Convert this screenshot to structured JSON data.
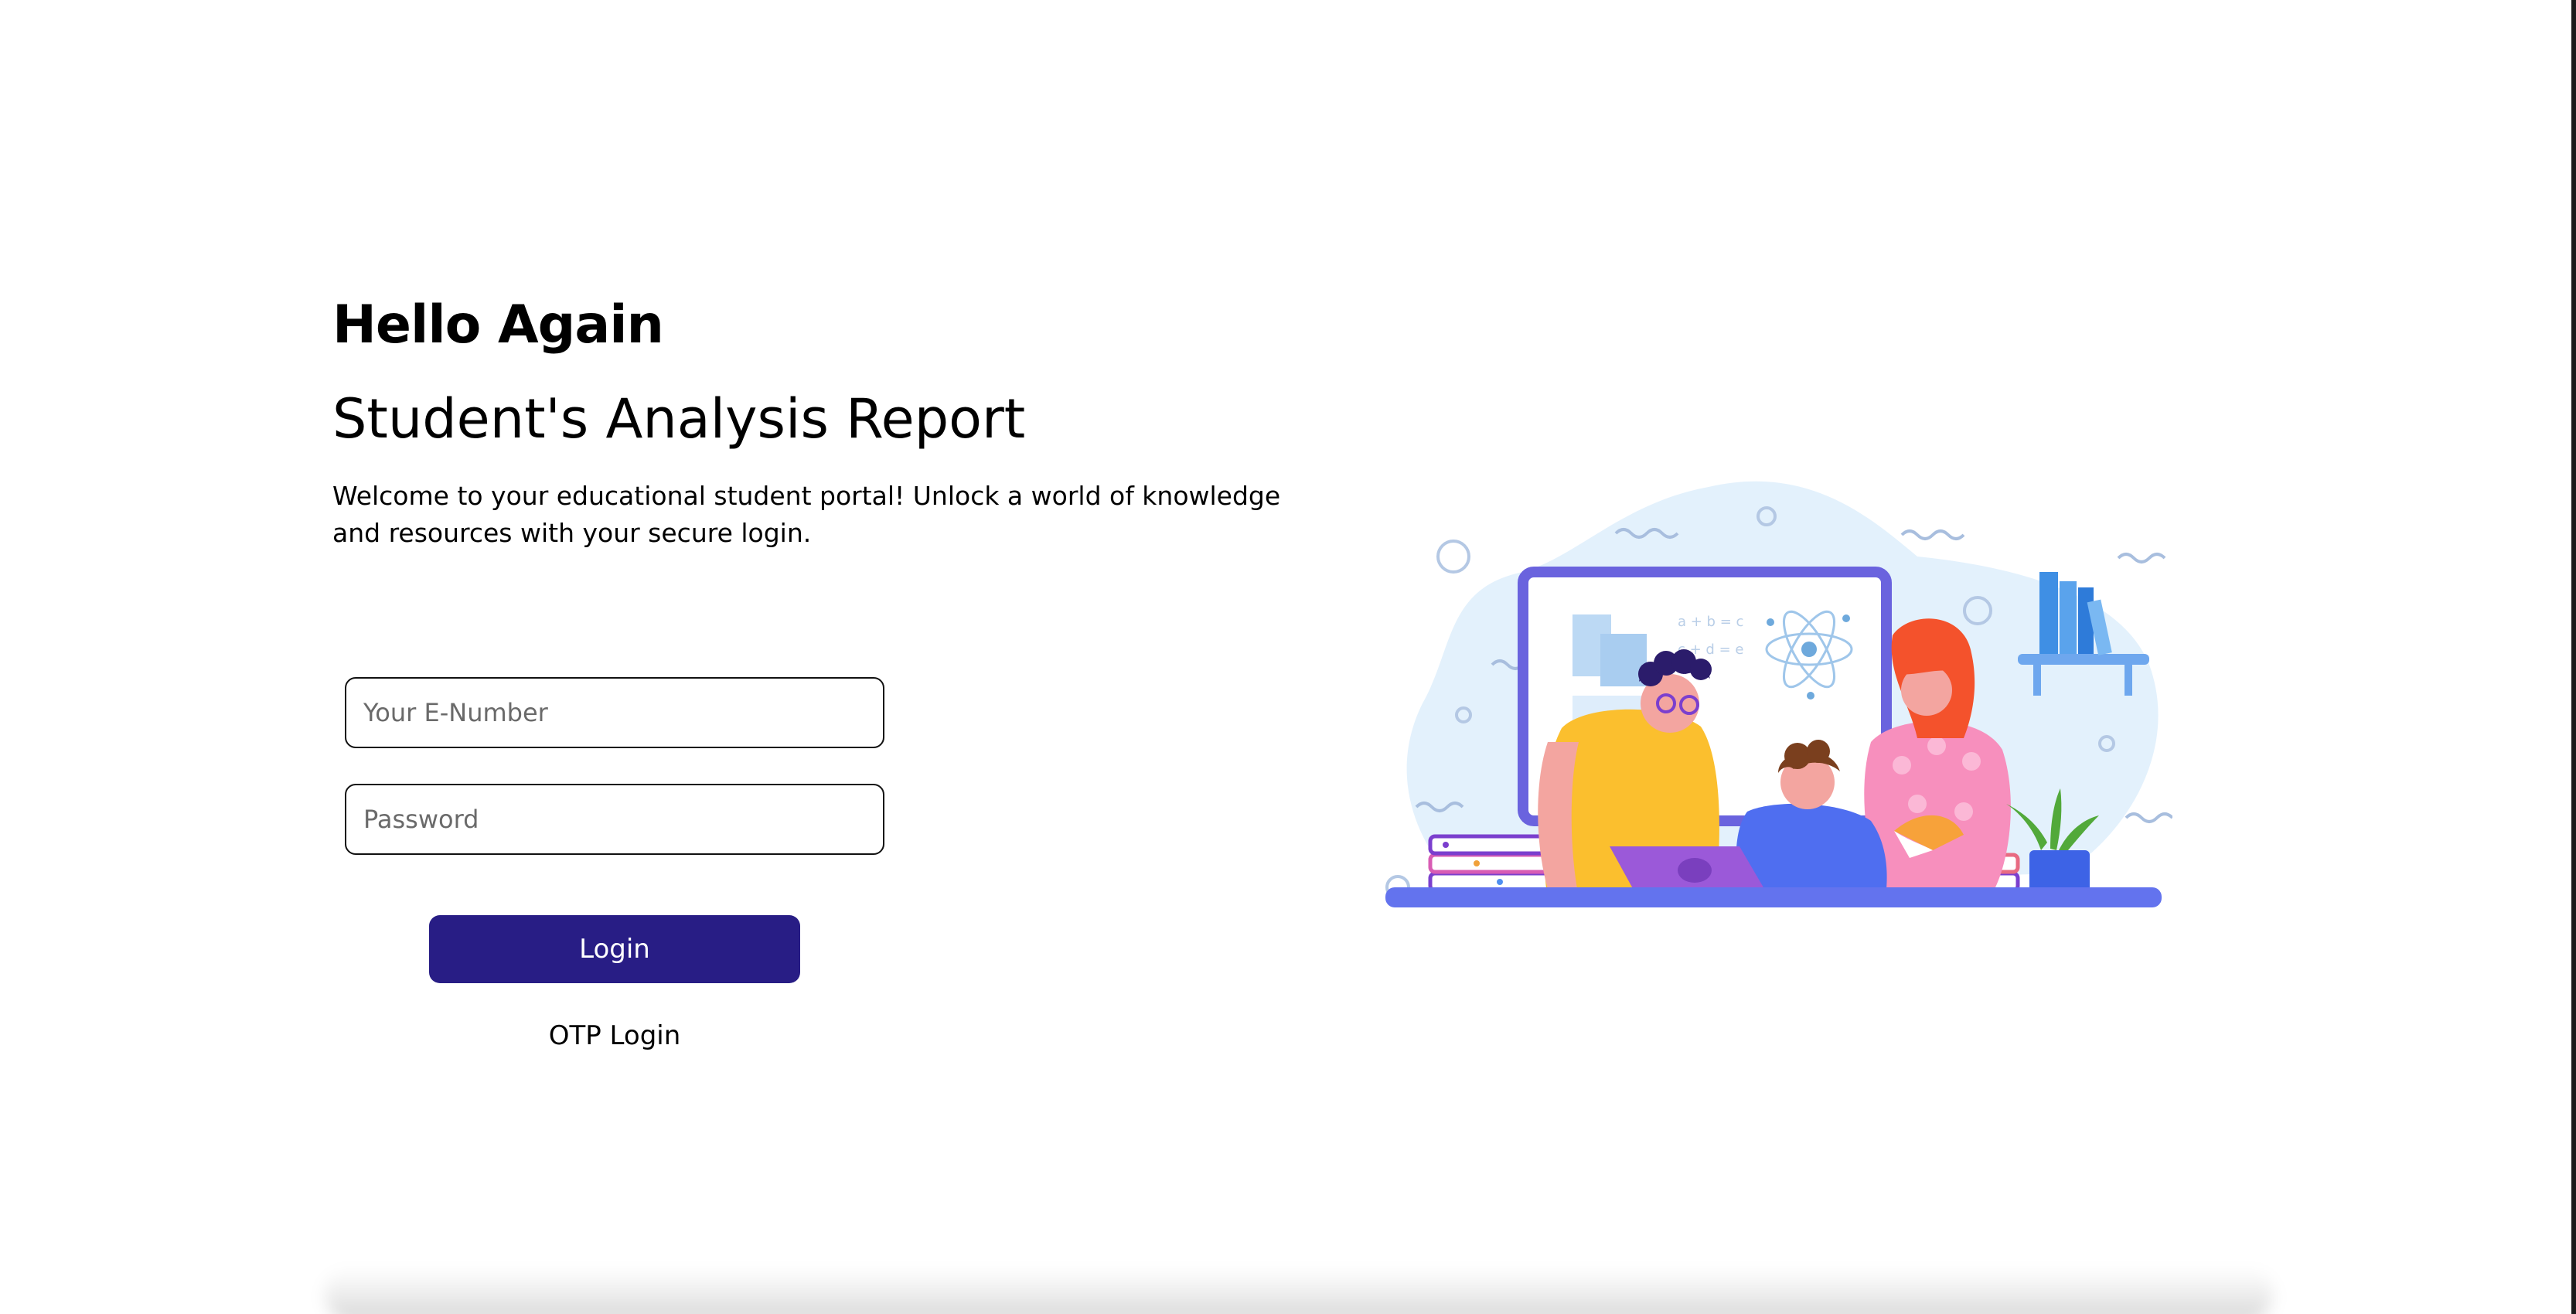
{
  "login": {
    "greeting": "Hello Again",
    "title": "Student's Analysis Report",
    "description": "Welcome to your educational student portal! Unlock a world of knowledge and resources with your secure login.",
    "email_placeholder": "Your E-Number",
    "password_placeholder": "Password",
    "login_button": "Login",
    "otp_link": "OTP Login"
  },
  "colors": {
    "primary_button": "#281d85",
    "input_border": "#111111",
    "background": "#ffffff"
  },
  "illustration": {
    "icon": "students-learning-illustration",
    "board_formula_1": "a + b = c",
    "board_formula_2": "c + d = e"
  }
}
